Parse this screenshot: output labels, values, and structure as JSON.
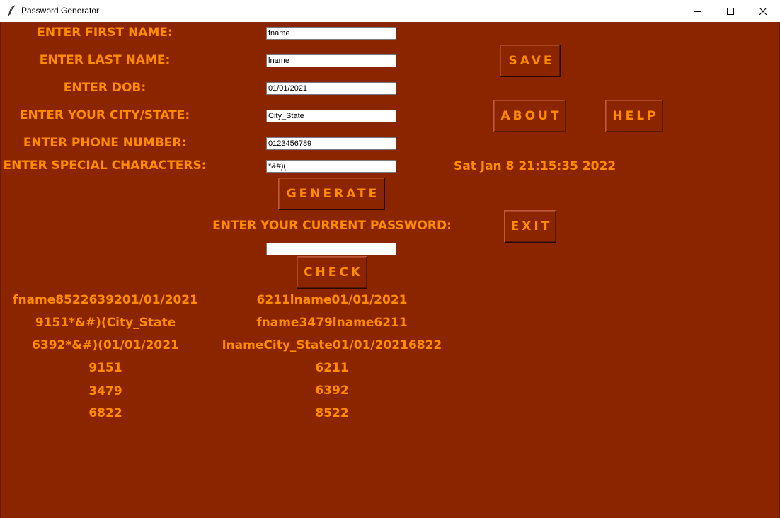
{
  "window": {
    "title": "Password Generator",
    "controls": [
      "minimize",
      "maximize",
      "close"
    ]
  },
  "form": {
    "first_name_label": "ENTER FIRST NAME:",
    "first_name_value": "fname",
    "last_name_label": "ENTER LAST NAME:",
    "last_name_value": "lname",
    "dob_label": "ENTER DOB:",
    "dob_value": "01/01/2021",
    "city_label": "ENTER YOUR CITY/STATE:",
    "city_value": "City_State",
    "phone_label": "ENTER PHONE NUMBER:",
    "phone_value": "0123456789",
    "special_label": "ENTER SPECIAL CHARACTERS:",
    "special_value": "*&#)(",
    "current_password_label": "ENTER YOUR CURRENT PASSWORD:",
    "current_password_value": ""
  },
  "buttons": {
    "save": "SAVE",
    "about": "ABOUT",
    "help": "HELP",
    "generate": "GENERATE",
    "exit": "EXIT",
    "check": "CHECK"
  },
  "clock": "Sat Jan  8 21:15:35 2022",
  "results": {
    "left": [
      "fname8522639201/01/2021",
      "9151*&#)(City_State",
      "6392*&#)(01/01/2021",
      "9151",
      "3479",
      "6822"
    ],
    "right": [
      "6211lname01/01/2021",
      "fname3479lname6211",
      "lnameCity_State01/01/20216822",
      "6211",
      "6392",
      "8522"
    ]
  },
  "colors": {
    "background": "#8b2500",
    "text": "#ff8c00"
  }
}
